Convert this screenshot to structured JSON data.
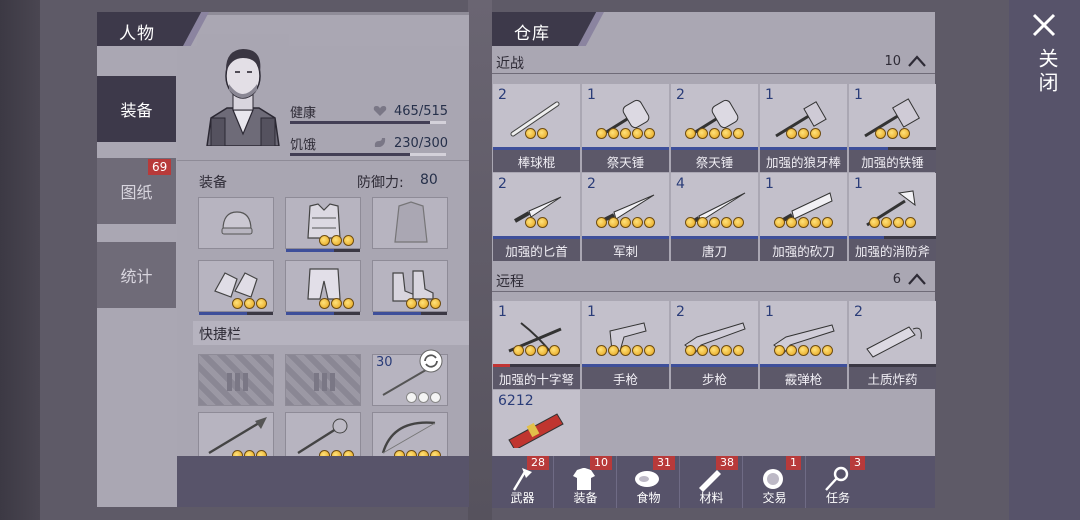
{
  "character": {
    "title": "人物",
    "tabs": [
      {
        "label": "装备",
        "badge": ""
      },
      {
        "label": "图纸",
        "badge": "69"
      },
      {
        "label": "统计",
        "badge": ""
      }
    ],
    "health": {
      "label": "健康",
      "value": "465/515",
      "fraction": 0.9
    },
    "hunger": {
      "label": "饥饿",
      "value": "230/300",
      "fraction": 0.77
    },
    "equipment_label": "装备",
    "defense_label": "防御力:",
    "defense_value": "80",
    "quickbar_label": "快捷栏",
    "quickbar_count": "30"
  },
  "storage": {
    "title": "仓库",
    "melee": {
      "label": "近战",
      "count": "10",
      "items": [
        {
          "qty": "2",
          "name": "棒球棍",
          "stars": 2,
          "durability": 1.0
        },
        {
          "qty": "1",
          "name": "祭天锤",
          "stars": 5,
          "durability": 1.0
        },
        {
          "qty": "2",
          "name": "祭天锤",
          "stars": 5,
          "durability": 1.0
        },
        {
          "qty": "1",
          "name": "加强的狼牙棒",
          "stars": 3,
          "durability": 1.0
        },
        {
          "qty": "1",
          "name": "加强的铁锤",
          "stars": 3,
          "durability": 0.45
        },
        {
          "qty": "2",
          "name": "加强的匕首",
          "stars": 2,
          "durability": 1.0
        },
        {
          "qty": "2",
          "name": "军刺",
          "stars": 5,
          "durability": 1.0
        },
        {
          "qty": "4",
          "name": "唐刀",
          "stars": 5,
          "durability": 1.0
        },
        {
          "qty": "1",
          "name": "加强的砍刀",
          "stars": 5,
          "durability": 1.0
        },
        {
          "qty": "1",
          "name": "加强的消防斧",
          "stars": 4,
          "durability": 0.4
        }
      ]
    },
    "ranged": {
      "label": "远程",
      "count": "6",
      "items": [
        {
          "qty": "1",
          "name": "加强的十字弩",
          "stars": 4,
          "durability": 0.2
        },
        {
          "qty": "1",
          "name": "手枪",
          "stars": 5,
          "durability": 1.0
        },
        {
          "qty": "2",
          "name": "步枪",
          "stars": 5,
          "durability": 1.0
        },
        {
          "qty": "1",
          "name": "霰弹枪",
          "stars": 5,
          "durability": 1.0
        },
        {
          "qty": "2",
          "name": "土质炸药",
          "stars": 0,
          "durability": 0
        },
        {
          "qty": "6212",
          "name": "",
          "stars": 0,
          "durability": 0
        }
      ]
    },
    "categories": [
      {
        "label": "武器",
        "badge": "28"
      },
      {
        "label": "装备",
        "badge": "10"
      },
      {
        "label": "食物",
        "badge": "31"
      },
      {
        "label": "材料",
        "badge": "38"
      },
      {
        "label": "交易",
        "badge": "1"
      },
      {
        "label": "任务",
        "badge": "3"
      }
    ]
  },
  "close_label": "关闭",
  "colors": {
    "star": "#f2c12e",
    "badge": "#b83a3a",
    "panel_dark": "#3d394a"
  }
}
